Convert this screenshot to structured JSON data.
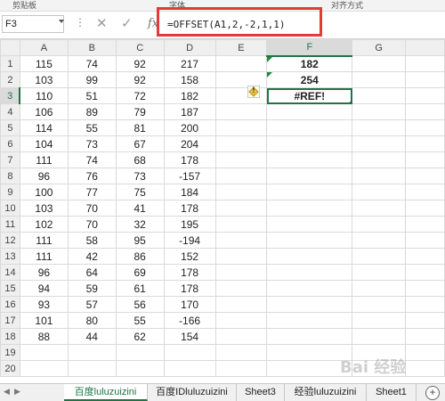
{
  "ribbon": {
    "group_labels": [
      "剪贴板",
      "字体",
      "对齐方式"
    ]
  },
  "formula_bar": {
    "name_box": "F3",
    "formula": "=OFFSET(A1,2,-2,1,1)",
    "fx_label": "fx",
    "cancel_icon": "close-icon",
    "confirm_icon": "check-icon"
  },
  "columns": [
    "A",
    "B",
    "C",
    "D",
    "E",
    "F",
    "G"
  ],
  "rows": [
    {
      "n": "1",
      "A": "115",
      "B": "74",
      "C": "92",
      "D": "217",
      "F": "182"
    },
    {
      "n": "2",
      "A": "103",
      "B": "99",
      "C": "92",
      "D": "158",
      "F": "254"
    },
    {
      "n": "3",
      "A": "110",
      "B": "51",
      "C": "72",
      "D": "182",
      "F": "#REF!"
    },
    {
      "n": "4",
      "A": "106",
      "B": "89",
      "C": "79",
      "D": "187",
      "F": ""
    },
    {
      "n": "5",
      "A": "114",
      "B": "55",
      "C": "81",
      "D": "200",
      "F": ""
    },
    {
      "n": "6",
      "A": "104",
      "B": "73",
      "C": "67",
      "D": "204",
      "F": ""
    },
    {
      "n": "7",
      "A": "111",
      "B": "74",
      "C": "68",
      "D": "178",
      "F": ""
    },
    {
      "n": "8",
      "A": "96",
      "B": "76",
      "C": "73",
      "D": "-157",
      "F": ""
    },
    {
      "n": "9",
      "A": "100",
      "B": "77",
      "C": "75",
      "D": "184",
      "F": ""
    },
    {
      "n": "10",
      "A": "103",
      "B": "70",
      "C": "41",
      "D": "178",
      "F": ""
    },
    {
      "n": "11",
      "A": "102",
      "B": "70",
      "C": "32",
      "D": "195",
      "F": ""
    },
    {
      "n": "12",
      "A": "111",
      "B": "58",
      "C": "95",
      "D": "-194",
      "F": ""
    },
    {
      "n": "13",
      "A": "111",
      "B": "42",
      "C": "86",
      "D": "152",
      "F": ""
    },
    {
      "n": "14",
      "A": "96",
      "B": "64",
      "C": "69",
      "D": "178",
      "F": ""
    },
    {
      "n": "15",
      "A": "94",
      "B": "59",
      "C": "61",
      "D": "178",
      "F": ""
    },
    {
      "n": "16",
      "A": "93",
      "B": "57",
      "C": "56",
      "D": "170",
      "F": ""
    },
    {
      "n": "17",
      "A": "101",
      "B": "80",
      "C": "55",
      "D": "-166",
      "F": ""
    },
    {
      "n": "18",
      "A": "88",
      "B": "44",
      "C": "62",
      "D": "154",
      "F": ""
    },
    {
      "n": "19",
      "A": "",
      "B": "",
      "C": "",
      "D": "",
      "F": ""
    },
    {
      "n": "20",
      "A": "",
      "B": "",
      "C": "",
      "D": "",
      "F": ""
    }
  ],
  "active_cell": {
    "column": "F",
    "row": "3"
  },
  "error_indicator": {
    "label": "!",
    "icon": "warning-icon"
  },
  "sheet_tabs": [
    "百度luluzuizini",
    "百度IDluluzuizini",
    "Sheet3",
    "经验luluzuizini",
    "Sheet1"
  ],
  "active_sheet_index": 0,
  "add_sheet_label": "+",
  "watermark": "Bai 经验",
  "colors": {
    "accent": "#217346",
    "highlight_box": "#e43a3a"
  }
}
